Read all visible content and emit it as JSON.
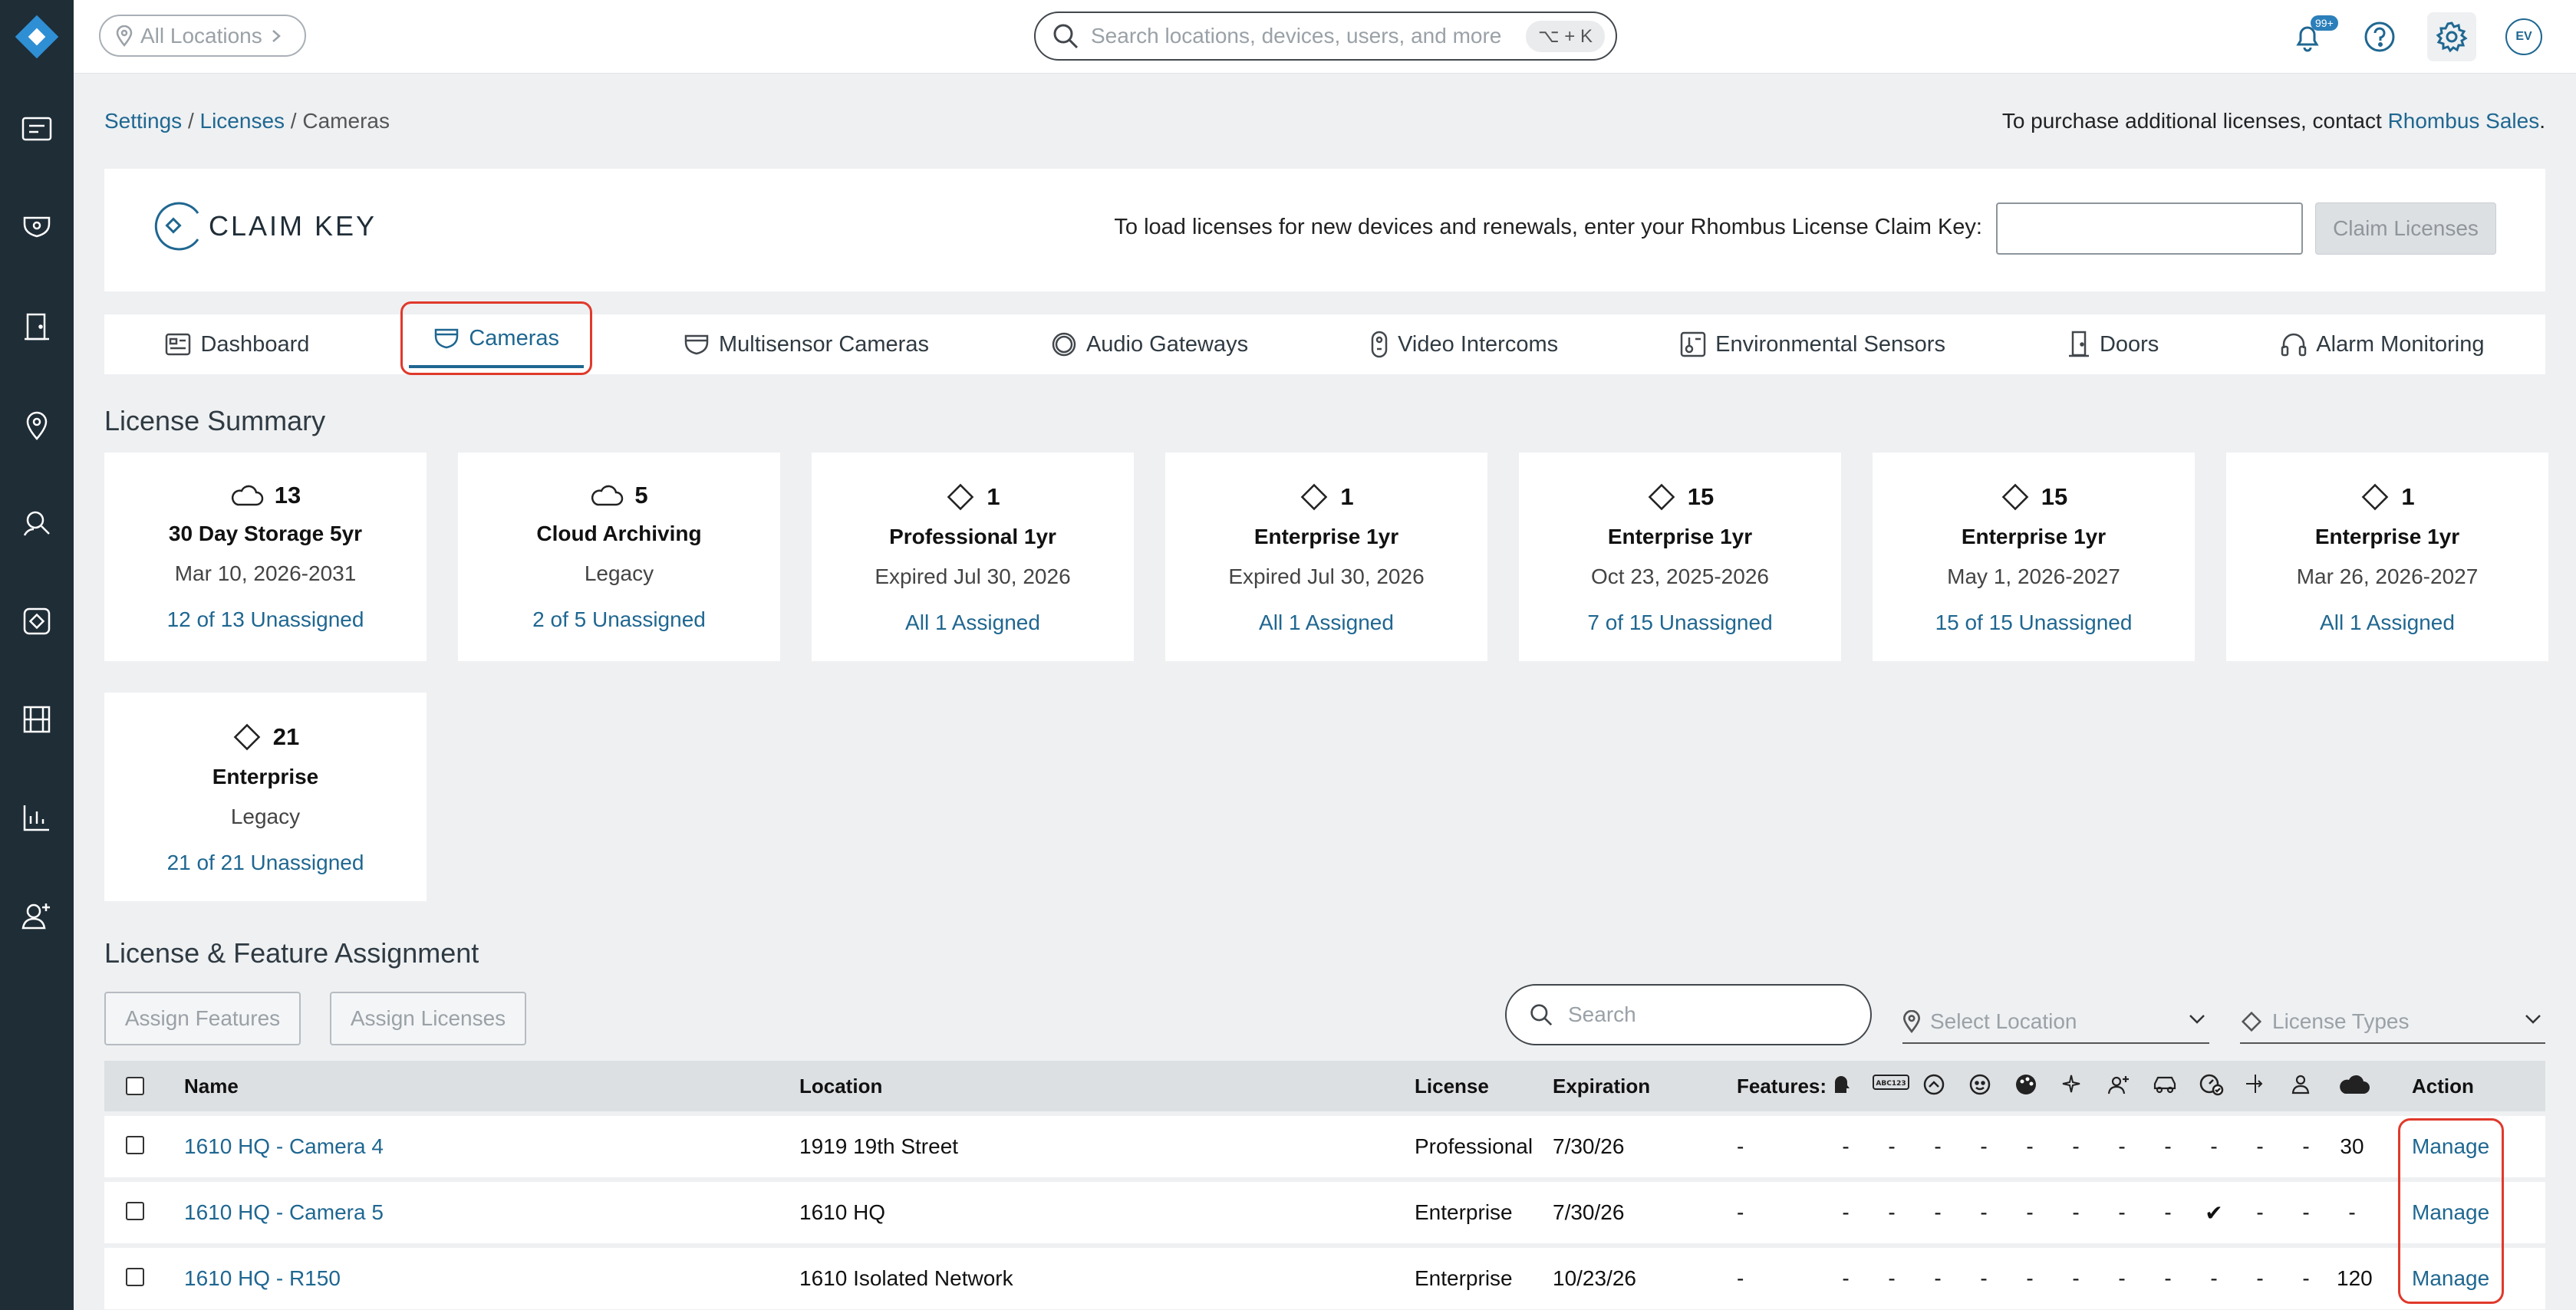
{
  "topbar": {
    "location_pill": "All Locations",
    "search_placeholder": "Search locations, devices, users, and more",
    "search_shortcut": "⌥ + K",
    "notif_badge": "99+",
    "avatar_initials": "EV"
  },
  "breadcrumb": {
    "settings": "Settings",
    "sep1": " / ",
    "licenses": "Licenses",
    "sep2": " / ",
    "current": "Cameras"
  },
  "purchase": {
    "text": "To purchase additional licenses, contact ",
    "link": "Rhombus Sales",
    "end": "."
  },
  "claim": {
    "logo_text": "CLAIM KEY",
    "label": "To load licenses for new devices and renewals, enter your Rhombus License Claim Key:",
    "input_value": "",
    "button": "Claim Licenses"
  },
  "tabs": [
    {
      "label": "Dashboard",
      "icon": "dashboard-icon"
    },
    {
      "label": "Cameras",
      "icon": "camera-icon",
      "active": true
    },
    {
      "label": "Multisensor Cameras",
      "icon": "multisensor-camera-icon"
    },
    {
      "label": "Audio Gateways",
      "icon": "audio-gateway-icon"
    },
    {
      "label": "Video Intercoms",
      "icon": "intercom-icon"
    },
    {
      "label": "Environmental Sensors",
      "icon": "sensor-icon"
    },
    {
      "label": "Doors",
      "icon": "door-icon"
    },
    {
      "label": "Alarm Monitoring",
      "icon": "headset-icon"
    }
  ],
  "summary": {
    "title": "License Summary",
    "cards": [
      {
        "icon": "cloud-icon",
        "count": "13",
        "type": "30 Day Storage 5yr",
        "dates": "Mar 10, 2026-2031",
        "assign": "12 of 13 Unassigned"
      },
      {
        "icon": "cloud-icon",
        "count": "5",
        "type": "Cloud Archiving",
        "dates": "Legacy",
        "assign": "2 of 5 Unassigned"
      },
      {
        "icon": "diamond-icon",
        "count": "1",
        "type": "Professional 1yr",
        "dates": "Expired Jul 30, 2026",
        "assign": "All 1 Assigned"
      },
      {
        "icon": "diamond-icon",
        "count": "1",
        "type": "Enterprise 1yr",
        "dates": "Expired Jul 30, 2026",
        "assign": "All 1 Assigned"
      },
      {
        "icon": "diamond-icon",
        "count": "15",
        "type": "Enterprise 1yr",
        "dates": "Oct 23, 2025-2026",
        "assign": "7 of 15 Unassigned"
      },
      {
        "icon": "diamond-icon",
        "count": "15",
        "type": "Enterprise 1yr",
        "dates": "May 1, 2026-2027",
        "assign": "15 of 15 Unassigned"
      },
      {
        "icon": "diamond-icon",
        "count": "1",
        "type": "Enterprise 1yr",
        "dates": "Mar 26, 2026-2027",
        "assign": "All 1 Assigned"
      },
      {
        "icon": "diamond-icon",
        "count": "21",
        "type": "Enterprise",
        "dates": "Legacy",
        "assign": "21 of 21 Unassigned"
      }
    ]
  },
  "assignment": {
    "title": "License & Feature Assignment",
    "assign_features": "Assign Features",
    "assign_licenses": "Assign Licenses",
    "search_placeholder": "Search",
    "select_location": "Select Location",
    "license_types": "License Types"
  },
  "table": {
    "headers": {
      "name": "Name",
      "location": "Location",
      "license": "License",
      "expiration": "Expiration",
      "features": "Features:",
      "action": "Action"
    },
    "feature_icons": [
      "face-icon",
      "plate-icon",
      "motion-icon",
      "face-search-icon",
      "color-icon",
      "sparkle-icon",
      "person-add-icon",
      "vehicle-icon",
      "speed-icon",
      "crossing-icon",
      "person-icon",
      "cloud-icon"
    ],
    "rows": [
      {
        "name": "1610 HQ - Camera 4",
        "location": "1919 19th Street",
        "license": "Professional",
        "expiration": "7/30/26",
        "features_col": "-",
        "features": [
          "-",
          "-",
          "-",
          "-",
          "-",
          "-",
          "-",
          "-",
          "-",
          "-",
          "-",
          "30"
        ],
        "action": "Manage"
      },
      {
        "name": "1610 HQ - Camera 5",
        "location": "1610 HQ",
        "license": "Enterprise",
        "expiration": "7/30/26",
        "features_col": "-",
        "features": [
          "-",
          "-",
          "-",
          "-",
          "-",
          "-",
          "-",
          "-",
          "✔",
          "-",
          "-",
          "-"
        ],
        "action": "Manage"
      },
      {
        "name": "1610 HQ - R150",
        "location": "1610 Isolated Network",
        "license": "Enterprise",
        "expiration": "10/23/26",
        "features_col": "-",
        "features": [
          "-",
          "-",
          "-",
          "-",
          "-",
          "-",
          "-",
          "-",
          "-",
          "-",
          "-",
          "120"
        ],
        "action": "Manage"
      }
    ]
  },
  "colors": {
    "accent": "#1f6791",
    "nav_bg": "#1f2d37",
    "highlight": "#e0392b"
  }
}
